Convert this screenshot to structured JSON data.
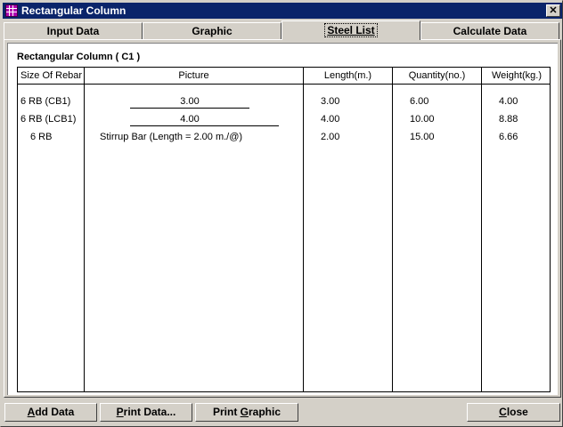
{
  "window": {
    "title": "Rectangular Column",
    "close_glyph": "✕"
  },
  "tabs": [
    {
      "label": "Input Data",
      "active": false
    },
    {
      "label": "Graphic",
      "active": false
    },
    {
      "label": "Steel List",
      "active": true
    },
    {
      "label": "Calculate Data",
      "active": false
    }
  ],
  "panel": {
    "heading": "Rectangular Column ( C1 )"
  },
  "table": {
    "headers": [
      "Size Of Rebar",
      "Picture",
      "Length(m.)",
      "Quantity(no.)",
      "Weight(kg.)"
    ],
    "rows": [
      {
        "size": "6 RB (CB1)",
        "picture": "3.00",
        "length": "3.00",
        "quantity": "6.00",
        "weight": "4.00"
      },
      {
        "size": "6 RB (LCB1)",
        "picture": "4.00",
        "length": "4.00",
        "quantity": "10.00",
        "weight": "8.88"
      },
      {
        "size": "6 RB",
        "picture": "Stirrup Bar (Length = 2.00 m./@)",
        "length": "2.00",
        "quantity": "15.00",
        "weight": "6.66"
      }
    ]
  },
  "buttons": {
    "add_data": {
      "pre": "",
      "mnemonic": "A",
      "post": "dd Data"
    },
    "print_data": {
      "pre": "",
      "mnemonic": "P",
      "post": "rint Data..."
    },
    "print_graphic": {
      "pre": "Print ",
      "mnemonic": "G",
      "post": "raphic"
    },
    "close": {
      "pre": "",
      "mnemonic": "C",
      "post": "lose"
    }
  }
}
